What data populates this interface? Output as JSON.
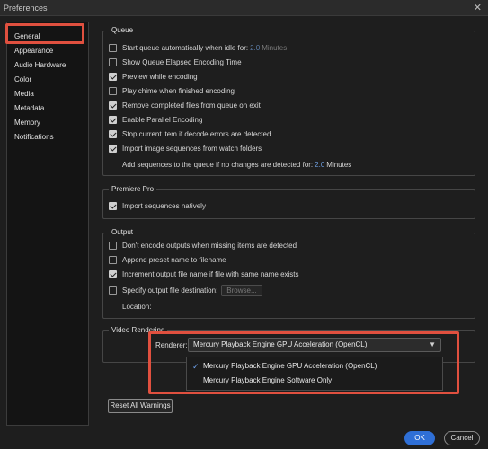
{
  "window": {
    "title": "Preferences",
    "close_glyph": "✕"
  },
  "sidebar": {
    "items": [
      {
        "label": "General"
      },
      {
        "label": "Appearance"
      },
      {
        "label": "Audio Hardware"
      },
      {
        "label": "Color"
      },
      {
        "label": "Media"
      },
      {
        "label": "Metadata"
      },
      {
        "label": "Memory"
      },
      {
        "label": "Notifications"
      }
    ],
    "selected": "General"
  },
  "queue": {
    "label": "Queue",
    "start_auto": {
      "label": "Start queue automatically when idle for:",
      "value": "2.0",
      "unit": "Minutes",
      "checked": false
    },
    "show_elapsed": {
      "label": "Show Queue Elapsed Encoding Time",
      "checked": false
    },
    "preview": {
      "label": "Preview while encoding",
      "checked": true
    },
    "play_chime": {
      "label": "Play chime when finished encoding",
      "checked": false
    },
    "remove_completed": {
      "label": "Remove completed files from queue on exit",
      "checked": true
    },
    "parallel": {
      "label": "Enable Parallel Encoding",
      "checked": true
    },
    "stop_errors": {
      "label": "Stop current item if decode errors are detected",
      "checked": true
    },
    "import_sequences": {
      "label": "Import image sequences from watch folders",
      "checked": true
    },
    "add_sequences": {
      "label": "Add sequences to the queue if no changes are detected for:",
      "value": "2.0",
      "unit": "Minutes"
    }
  },
  "premiere": {
    "label": "Premiere Pro",
    "import_natively": {
      "label": "Import sequences natively",
      "checked": true
    }
  },
  "output": {
    "label": "Output",
    "dont_encode": {
      "label": "Don't encode outputs when missing items are detected",
      "checked": false
    },
    "append_preset": {
      "label": "Append preset name to filename",
      "checked": false
    },
    "increment": {
      "label": "Increment output file name if file with same name exists",
      "checked": true
    },
    "specify_dest": {
      "label": "Specify output file destination:",
      "checked": false,
      "browse_label": "Browse..."
    },
    "location_label": "Location:"
  },
  "video_rendering": {
    "label": "Video Rendering",
    "renderer_label": "Renderer:",
    "selected": "Mercury Playback Engine GPU Acceleration (OpenCL)",
    "options": [
      "Mercury Playback Engine GPU Acceleration (OpenCL)",
      "Mercury Playback Engine Software Only"
    ]
  },
  "buttons": {
    "reset_warnings": "Reset All Warnings",
    "ok": "OK",
    "cancel": "Cancel"
  },
  "colors": {
    "accent": "#2f6fd6",
    "highlight_annotation": "#e0503f",
    "value_text": "#6f9fe0"
  }
}
